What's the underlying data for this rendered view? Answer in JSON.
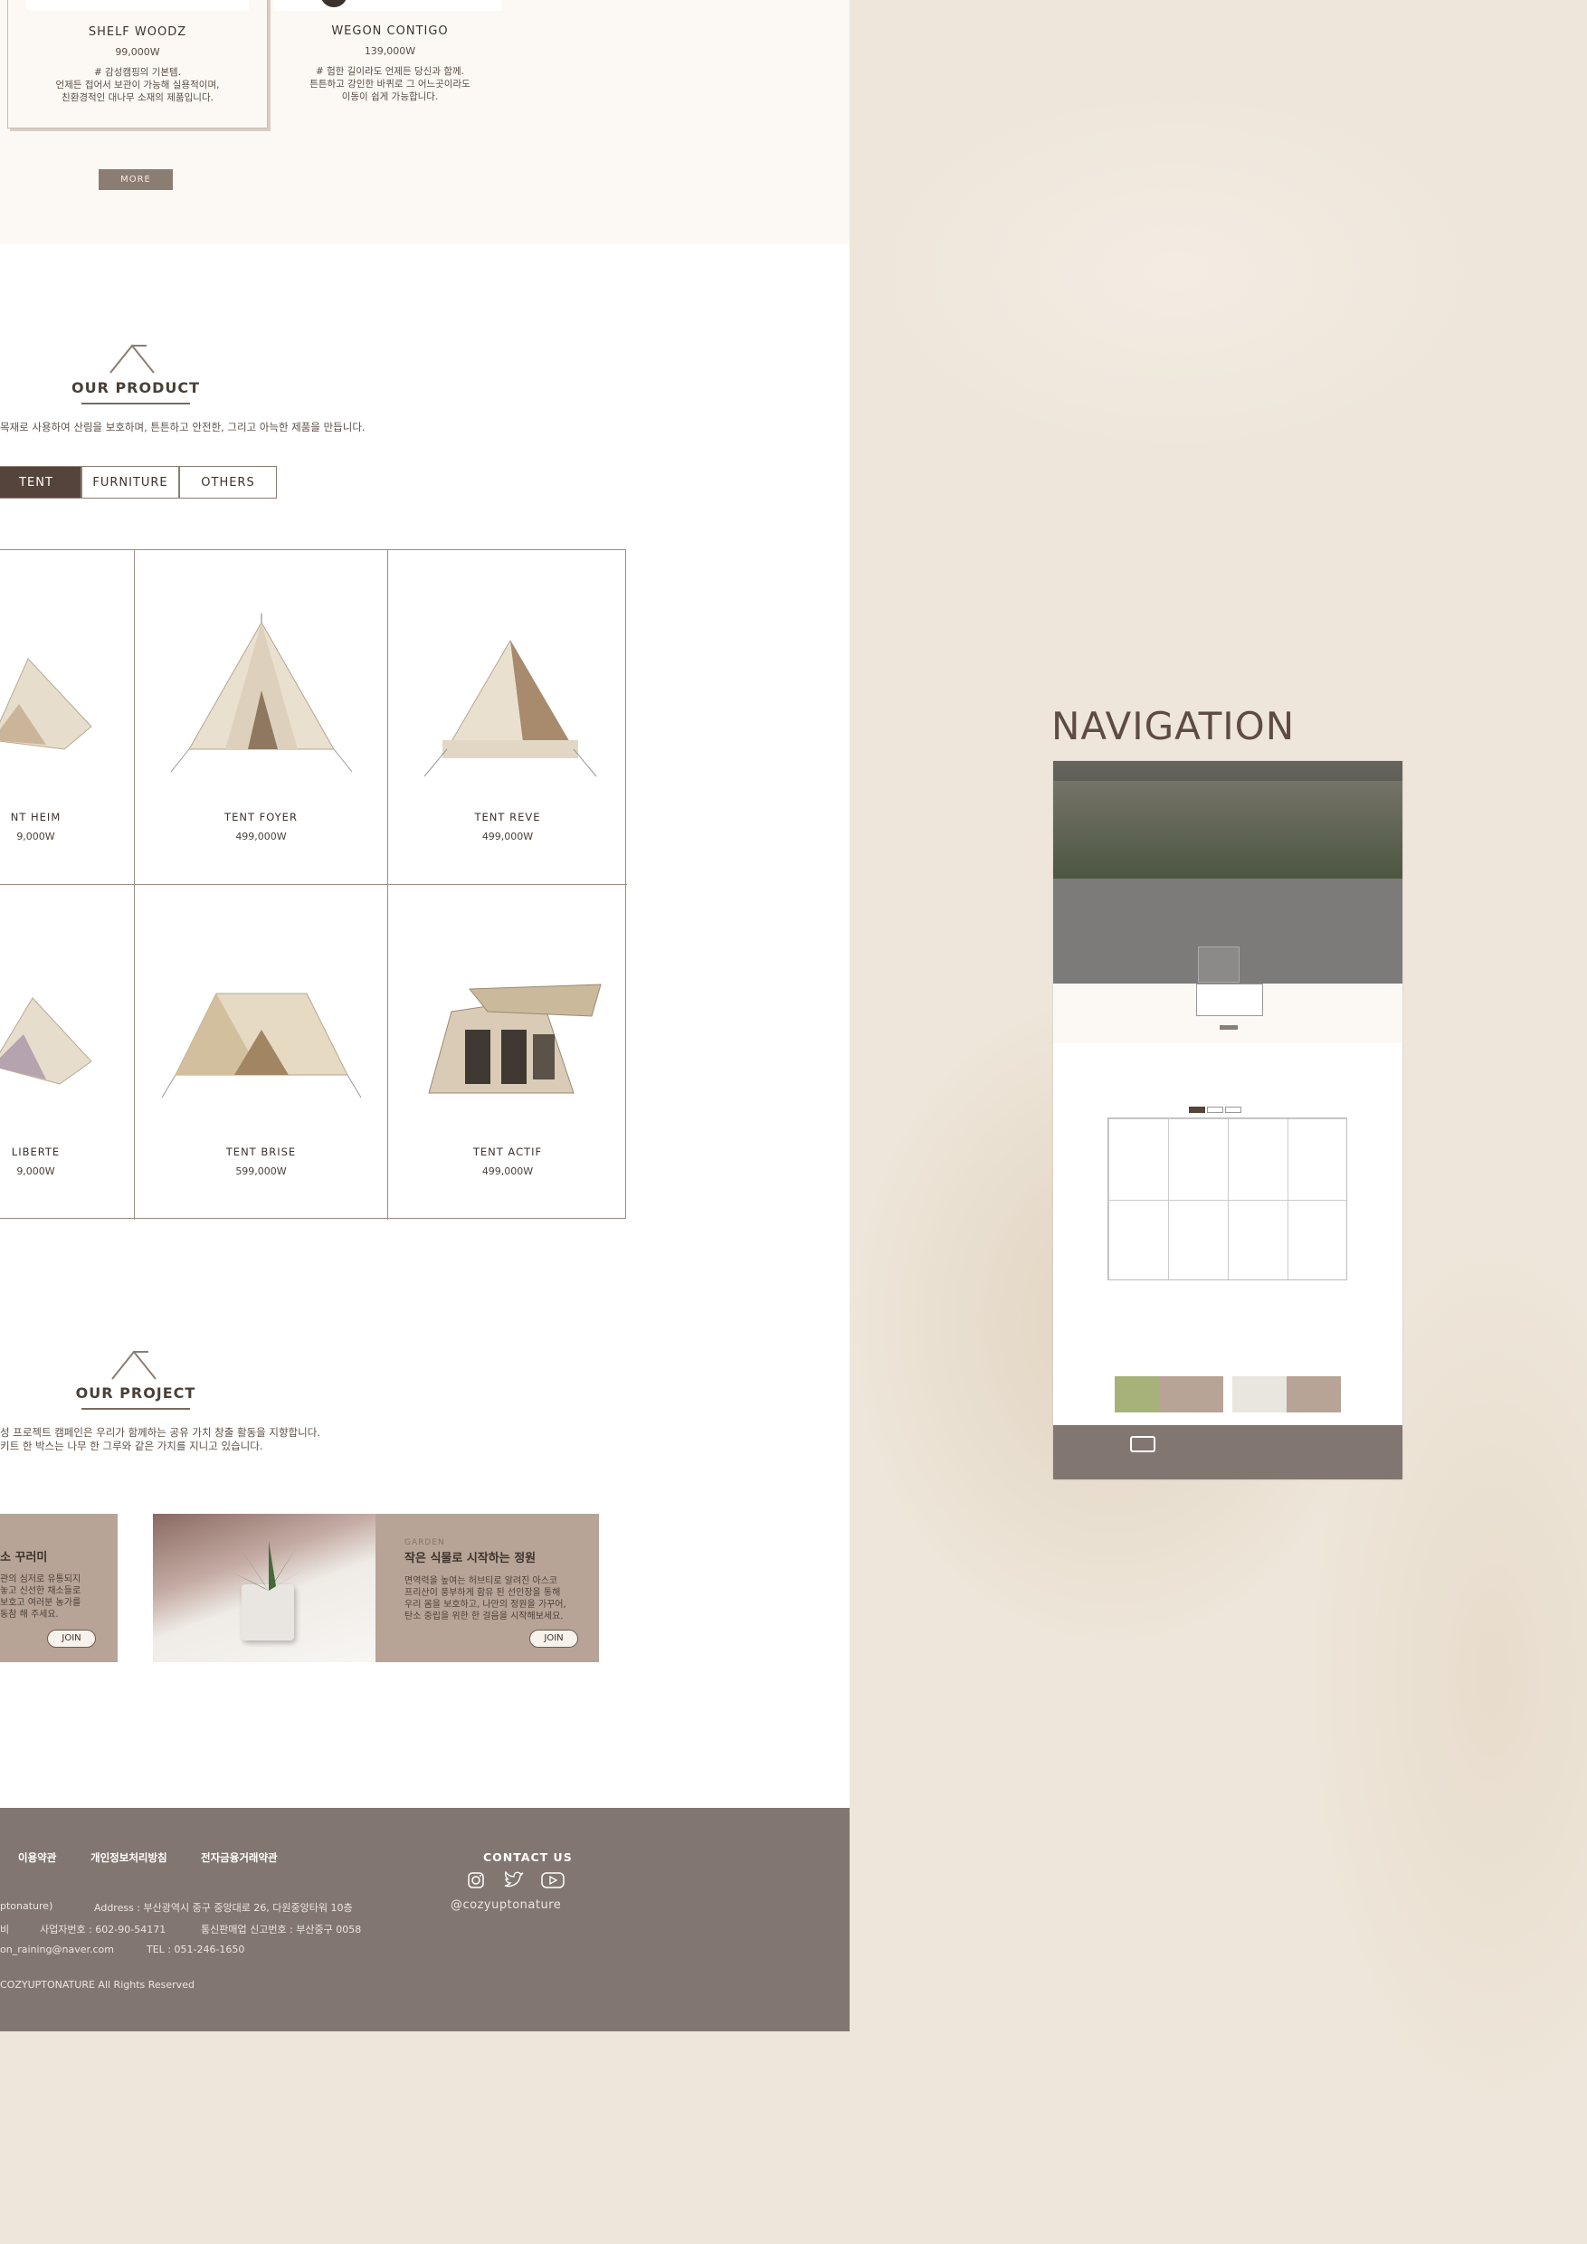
{
  "top_products": [
    {
      "name": "SHELF WOODZ",
      "price": "99,000W",
      "desc": "# 감성캠핑의 기본템.\n언제든 접어서 보관이 가능해 실용적이며,\n친환경적인 대나무 소재의 제품입니다."
    },
    {
      "name": "WEGON CONTIGO",
      "price": "139,000W",
      "desc": "# 험한 길이라도 언제든 당신과 함께.\n튼튼하고 강인한 바퀴로 그 어느곳이라도\n이동이 쉽게 가능합니다."
    }
  ],
  "more_label": "MORE",
  "our_product": {
    "heading": "OUR PRODUCT",
    "text": "목재로 사용하여 산림을 보호하며, 튼튼하고 안전한, 그리고 아늑한 제품을 만듭니다.",
    "tabs": [
      "TENT",
      "FURNITURE",
      "OTHERS"
    ],
    "items": [
      {
        "name": "NT HEIM",
        "price": "9,000W"
      },
      {
        "name": "TENT FOYER",
        "price": "499,000W"
      },
      {
        "name": "TENT REVE",
        "price": "499,000W"
      },
      {
        "name": "LIBERTE",
        "price": "9,000W"
      },
      {
        "name": "TENT BRISE",
        "price": "599,000W"
      },
      {
        "name": "TENT ACTIF",
        "price": "499,000W"
      }
    ]
  },
  "our_project": {
    "heading": "OUR PROJECT",
    "text": "성 프로젝트 캠페인은 우리가 함께하는 공유 가치 창출 활동을 지향합니다.\n키트 한 박스는 나무 한 그루와 같은 가치를 지니고 있습니다.",
    "cards": [
      {
        "sub": "",
        "title": "소 꾸러미",
        "text": "관의 심저로 유통되지\n놓고 신선한 채소들로\n보호고 여러분 농가를\n동참 해 주세요.",
        "join": "JOIN"
      },
      {
        "sub": "GARDEN",
        "title": "작은 식물로 시작하는 정원",
        "text": "면역력을 높여는 허브티로 알려진 아스코\n프리산이 풍부하게 함유 된 선인장을 통해\n우리 몸을 보호하고, 나만의 정원을 가꾸어,\n탄소 중립을 위한 한 걸음을 시작해보세요.",
        "join": "JOIN"
      }
    ]
  },
  "footer": {
    "links": [
      "이용약관",
      "개인정보처리방침",
      "전자금융거래약관"
    ],
    "contact_title": "CONTACT US",
    "handle": "@cozyuptonature",
    "line1_left": "ptonature)",
    "line1_right": "Address : 부산광역시 중구 중앙대로 26, 다원중앙타워 10층",
    "line2_left": "비",
    "line2_mid": "사업자번호 : 602-90-54171",
    "line2_right": "통신판매업 신고번호 : 부산중구 0058",
    "line3_left": "on_raining@naver.com",
    "line3_right": "TEL : 051-246-1650",
    "copyright": "COZYUPTONATURE All Rights Reserved",
    "icons": [
      "instagram-icon",
      "twitter-icon",
      "youtube-icon"
    ]
  },
  "navigation": {
    "title": "NAVIGATION"
  }
}
